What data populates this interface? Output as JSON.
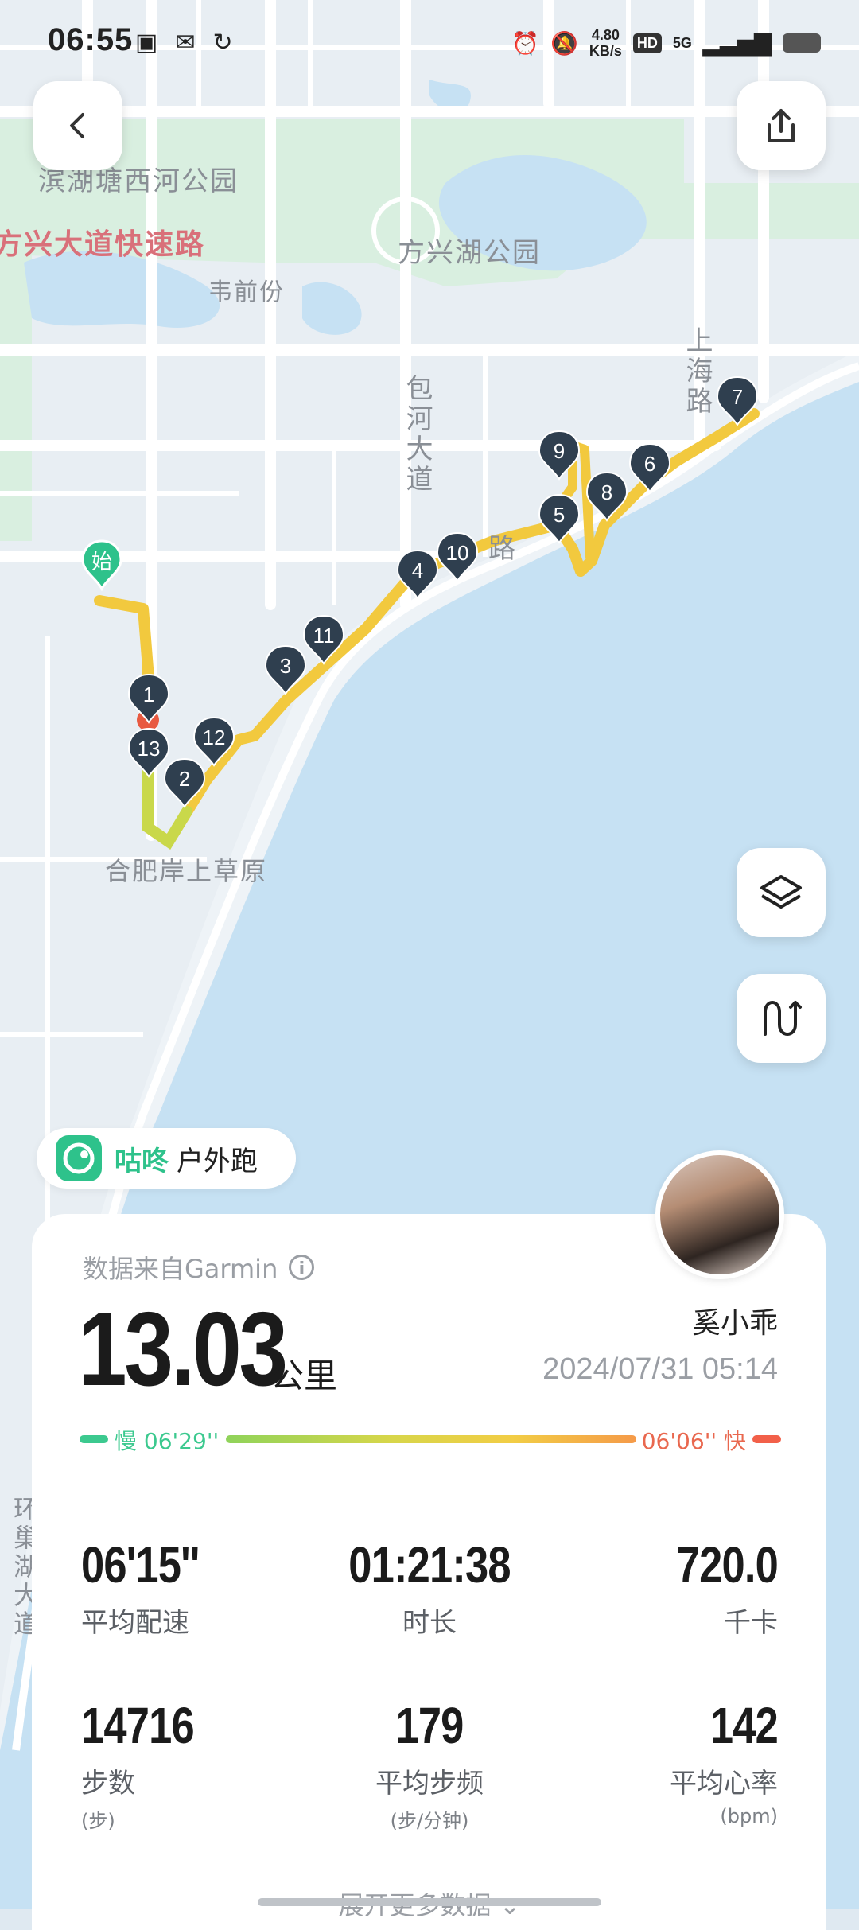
{
  "status_bar": {
    "time": "06:55",
    "net_speed_value": "4.80",
    "net_speed_unit": "KB/s",
    "hd": "HD",
    "signal": "5G"
  },
  "map": {
    "labels": {
      "park_west": "滨湖塘西河公园",
      "expressway": "方兴大道快速路",
      "weiqianfen": "韦前份",
      "fangxing_lake": "方兴湖公园",
      "baohe_avenue": "包河大道",
      "shanghai_road": "上海路",
      "grassland": "合肥岸上草原",
      "huanchao_avenue": "环巢湖大道",
      "road_partial": "路"
    },
    "start_pin": "始",
    "markers": [
      "1",
      "2",
      "3",
      "4",
      "5",
      "6",
      "7",
      "8",
      "9",
      "10",
      "11",
      "12",
      "13"
    ],
    "colors": {
      "route": "#f2c93e",
      "route_start": "#d2d94a",
      "marker": "#2f3f4f",
      "start_pin": "#2ec28b",
      "water": "#c6e1f3",
      "park": "#d7eedd"
    }
  },
  "buttons": {
    "back_icon": "chevron-left-icon",
    "share_icon": "share-icon",
    "layers_icon": "layers-icon",
    "route_icon": "route-icon"
  },
  "activity": {
    "brand": "咕咚",
    "type": "户外跑",
    "source": "数据来自Garmin",
    "distance": "13.03",
    "distance_unit": "公里",
    "username": "奚小乖",
    "datetime": "2024/07/31 05:14",
    "pace_slow": "慢 06'29''",
    "pace_fast": "06'06'' 快",
    "stats": [
      {
        "value": "06'15''",
        "label": "平均配速",
        "unit": ""
      },
      {
        "value": "01:21:38",
        "label": "时长",
        "unit": ""
      },
      {
        "value": "720.0",
        "label": "千卡",
        "unit": ""
      },
      {
        "value": "14716",
        "label": "步数",
        "unit": "(步)"
      },
      {
        "value": "179",
        "label": "平均步频",
        "unit": "(步/分钟)"
      },
      {
        "value": "142",
        "label": "平均心率",
        "unit": "(bpm)"
      }
    ],
    "expand_more": "展开更多数据 ⌄"
  }
}
